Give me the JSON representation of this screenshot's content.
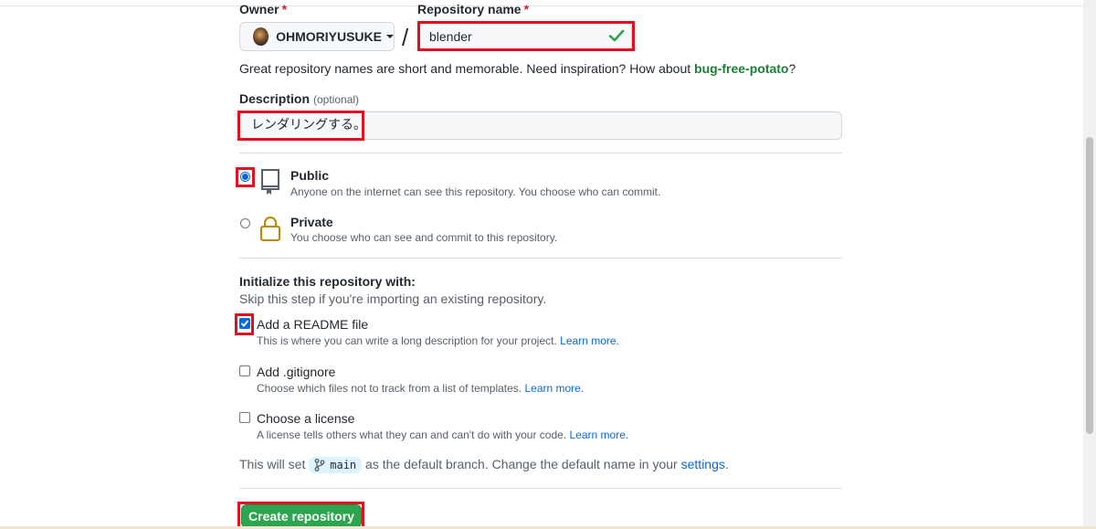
{
  "owner": {
    "label": "Owner",
    "required_mark": "*",
    "value": "OHMORIYUSUKE"
  },
  "repo_name": {
    "label": "Repository name",
    "required_mark": "*",
    "value": "blender",
    "valid": true
  },
  "separator": "/",
  "hint": {
    "text": "Great repository names are short and memorable. Need inspiration? How about ",
    "suggestion": "bug-free-potato",
    "end": "?"
  },
  "description": {
    "label": "Description",
    "optional": "(optional)",
    "value": "レンダリングする。"
  },
  "visibility": {
    "public": {
      "title": "Public",
      "desc": "Anyone on the internet can see this repository. You choose who can commit.",
      "selected": true
    },
    "private": {
      "title": "Private",
      "desc": "You choose who can see and commit to this repository.",
      "selected": false
    }
  },
  "init": {
    "title": "Initialize this repository with:",
    "subtitle": "Skip this step if you're importing an existing repository.",
    "readme": {
      "title": "Add a README file",
      "desc": "This is where you can write a long description for your project.",
      "link": "Learn more.",
      "checked": true
    },
    "gitignore": {
      "title": "Add .gitignore",
      "desc": "Choose which files not to track from a list of templates.",
      "link": "Learn more.",
      "checked": false
    },
    "license": {
      "title": "Choose a license",
      "desc": "A license tells others what they can and can't do with your code.",
      "link": "Learn more.",
      "checked": false
    }
  },
  "branch": {
    "prefix": "This will set",
    "name": "main",
    "middle": "as the default branch. Change the default name in your",
    "link": "settings",
    "end": "."
  },
  "create_button": "Create repository",
  "colors": {
    "highlight_box": "#e01020",
    "primary_button": "#2da44e",
    "link": "#0969da",
    "suggestion": "#1a7f37"
  }
}
